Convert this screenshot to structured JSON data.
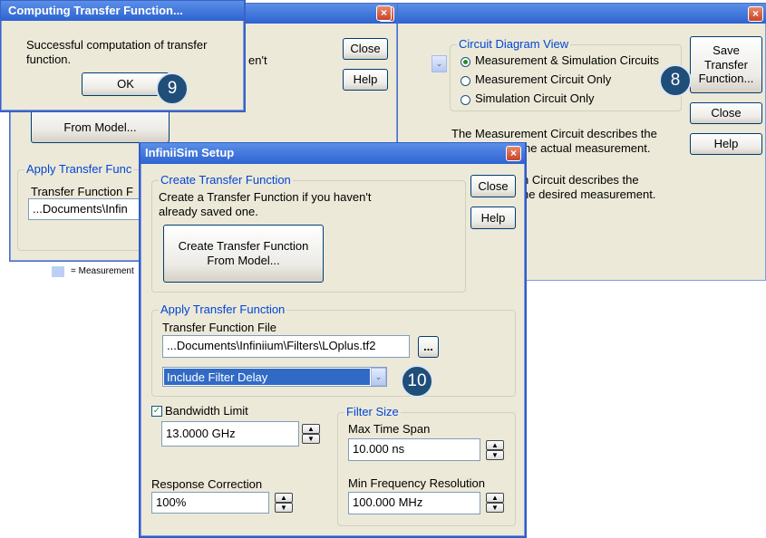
{
  "main_window": {
    "circuit_group_title": "Circuit Diagram View",
    "radio_options": [
      "Measurement & Simulation Circuits",
      "Measurement Circuit Only",
      "Simulation Circuit Only"
    ],
    "desc1": "The Measurement Circuit describes the",
    "desc1b": "he actual measurement.",
    "desc2": "n Circuit describes the",
    "desc2b": "he desired measurement.",
    "save_label": "Save\nTransfer\nFunction...",
    "close_label": "Close",
    "help_label": "Help",
    "close_icon": "×"
  },
  "back_left": {
    "hidden_text": "en't",
    "create_label": "From Model...",
    "close_label": "Close",
    "help_label": "Help",
    "apply_title": "Apply Transfer Func",
    "file_label": "Transfer Function F",
    "file_value": "...Documents\\Infin",
    "legend_text": "= Measurement"
  },
  "computing_dialog": {
    "title": "Computing Transfer Function...",
    "message": "Successful computation of transfer function.",
    "ok_label": "OK",
    "close_icon": "×"
  },
  "infiniisim": {
    "title": "InfiniiSim Setup",
    "create_group_title": "Create Transfer Function",
    "create_desc": "Create a Transfer Function if you haven't already saved one.",
    "create_button": "Create Transfer Function\nFrom Model...",
    "close_label": "Close",
    "help_label": "Help",
    "apply_group_title": "Apply Transfer Function",
    "file_label": "Transfer Function File",
    "file_value": "...Documents\\Infiniium\\Filters\\LOplus.tf2",
    "browse_label": "...",
    "delay_option": "Include Filter Delay",
    "bandwidth_label": "Bandwidth Limit",
    "bandwidth_value": "13.0000 GHz",
    "response_label": "Response Correction",
    "response_value": "100%",
    "filter_size_title": "Filter Size",
    "max_span_label": "Max Time Span",
    "max_span_value": "10.000 ns",
    "min_freq_label": "Min Frequency Resolution",
    "min_freq_value": "100.000 MHz",
    "close_icon": "×"
  },
  "callouts": {
    "step8": "8",
    "step9": "9",
    "step10": "10"
  }
}
